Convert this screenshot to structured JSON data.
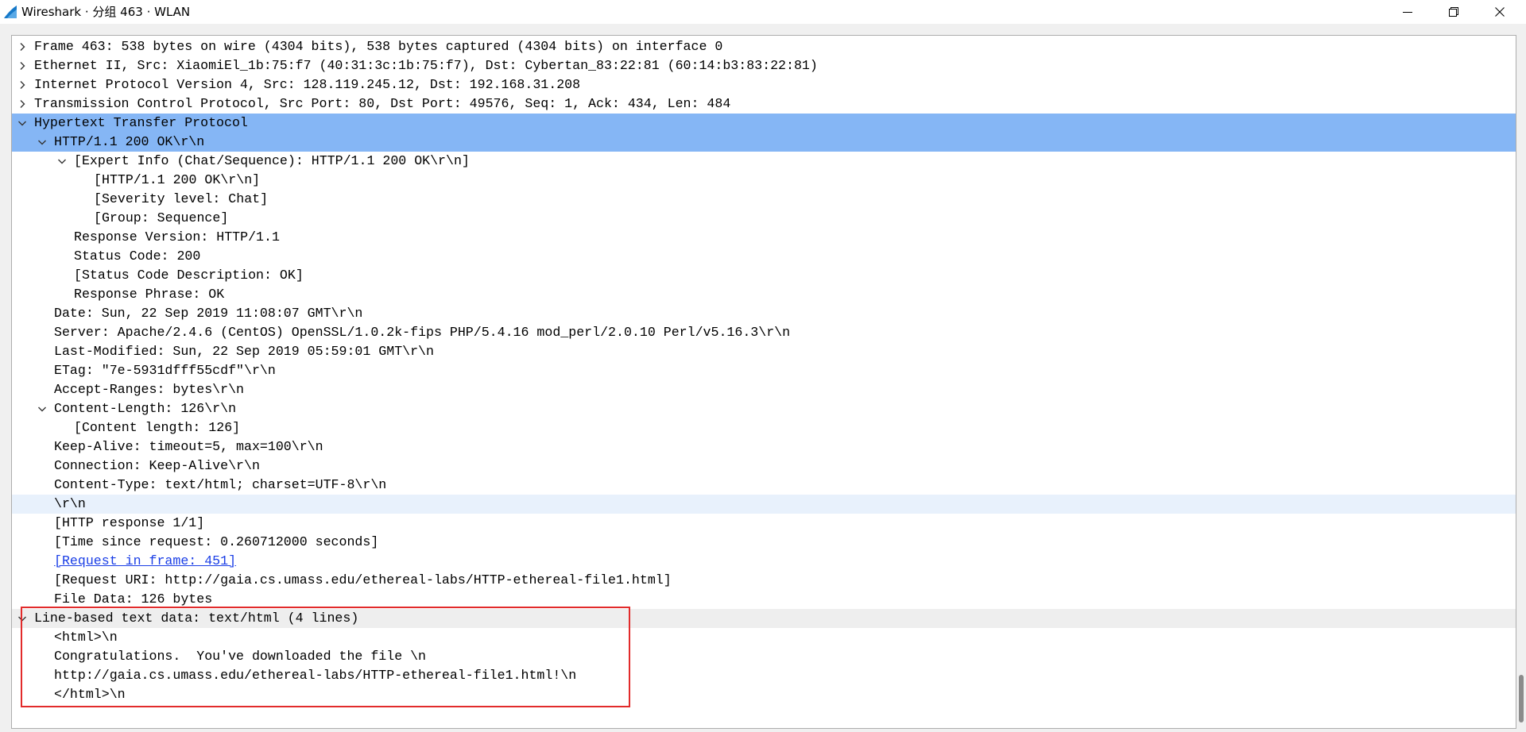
{
  "window": {
    "title": "Wireshark · 分组 463 · WLAN",
    "controls": [
      "minimize-icon",
      "maximize-icon",
      "close-icon"
    ]
  },
  "tree": {
    "rows": [
      {
        "text": "Frame 463: 538 bytes on wire (4304 bits), 538 bytes captured (4304 bits) on interface 0",
        "expander": "collapsed",
        "style": ""
      },
      {
        "text": "Ethernet II, Src: XiaomiEl_1b:75:f7 (40:31:3c:1b:75:f7), Dst: Cybertan_83:22:81 (60:14:b3:83:22:81)",
        "expander": "collapsed",
        "style": ""
      },
      {
        "text": "Internet Protocol Version 4, Src: 128.119.245.12, Dst: 192.168.31.208",
        "expander": "collapsed",
        "style": ""
      },
      {
        "text": "Transmission Control Protocol, Src Port: 80, Dst Port: 49576, Seq: 1, Ack: 434, Len: 484",
        "expander": "collapsed",
        "style": ""
      },
      {
        "text": "Hypertext Transfer Protocol",
        "expander": "expanded",
        "style": "selected"
      },
      {
        "text": "HTTP/1.1 200 OK\\r\\n",
        "expander": "expanded",
        "style": "selected"
      },
      {
        "text": "[Expert Info (Chat/Sequence): HTTP/1.1 200 OK\\r\\n]",
        "expander": "expanded",
        "style": ""
      },
      {
        "text": "[HTTP/1.1 200 OK\\r\\n]",
        "expander": "none",
        "style": ""
      },
      {
        "text": "[Severity level: Chat]",
        "expander": "none",
        "style": ""
      },
      {
        "text": "[Group: Sequence]",
        "expander": "none",
        "style": ""
      },
      {
        "text": "Response Version: HTTP/1.1",
        "expander": "none",
        "style": ""
      },
      {
        "text": "Status Code: 200",
        "expander": "none",
        "style": ""
      },
      {
        "text": "[Status Code Description: OK]",
        "expander": "none",
        "style": ""
      },
      {
        "text": "Response Phrase: OK",
        "expander": "none",
        "style": ""
      },
      {
        "text": "Date: Sun, 22 Sep 2019 11:08:07 GMT\\r\\n",
        "expander": "none",
        "style": ""
      },
      {
        "text": "Server: Apache/2.4.6 (CentOS) OpenSSL/1.0.2k-fips PHP/5.4.16 mod_perl/2.0.10 Perl/v5.16.3\\r\\n",
        "expander": "none",
        "style": ""
      },
      {
        "text": "Last-Modified: Sun, 22 Sep 2019 05:59:01 GMT\\r\\n",
        "expander": "none",
        "style": ""
      },
      {
        "text": "ETag: \"7e-5931dfff55cdf\"\\r\\n",
        "expander": "none",
        "style": ""
      },
      {
        "text": "Accept-Ranges: bytes\\r\\n",
        "expander": "none",
        "style": ""
      },
      {
        "text": "Content-Length: 126\\r\\n",
        "expander": "expanded",
        "style": ""
      },
      {
        "text": "[Content length: 126]",
        "expander": "none",
        "style": ""
      },
      {
        "text": "Keep-Alive: timeout=5, max=100\\r\\n",
        "expander": "none",
        "style": ""
      },
      {
        "text": "Connection: Keep-Alive\\r\\n",
        "expander": "none",
        "style": ""
      },
      {
        "text": "Content-Type: text/html; charset=UTF-8\\r\\n",
        "expander": "none",
        "style": ""
      },
      {
        "text": "\\r\\n",
        "expander": "none",
        "style": "focused"
      },
      {
        "text": "[HTTP response 1/1]",
        "expander": "none",
        "style": ""
      },
      {
        "text": "[Time since request: 0.260712000 seconds]",
        "expander": "none",
        "style": ""
      },
      {
        "text": "[Request in frame: 451]",
        "expander": "none",
        "style": "link"
      },
      {
        "text": "[Request URI: http://gaia.cs.umass.edu/ethereal-labs/HTTP-ethereal-file1.html]",
        "expander": "none",
        "style": ""
      },
      {
        "text": "File Data: 126 bytes",
        "expander": "none",
        "style": ""
      },
      {
        "text": "Line-based text data: text/html (4 lines)",
        "expander": "expanded",
        "style": "group"
      },
      {
        "text": "<html>\\n",
        "expander": "none",
        "style": ""
      },
      {
        "text": "Congratulations.  You've downloaded the file \\n",
        "expander": "none",
        "style": ""
      },
      {
        "text": "http://gaia.cs.umass.edu/ethereal-labs/HTTP-ethereal-file1.html!\\n",
        "expander": "none",
        "style": ""
      },
      {
        "text": "</html>\\n",
        "expander": "none",
        "style": ""
      }
    ]
  },
  "annotation": {
    "color": "#e22b2b"
  },
  "colors": {
    "selected": "#85b6f5",
    "focused": "#e8f1fc",
    "link": "#1a3ee6"
  }
}
